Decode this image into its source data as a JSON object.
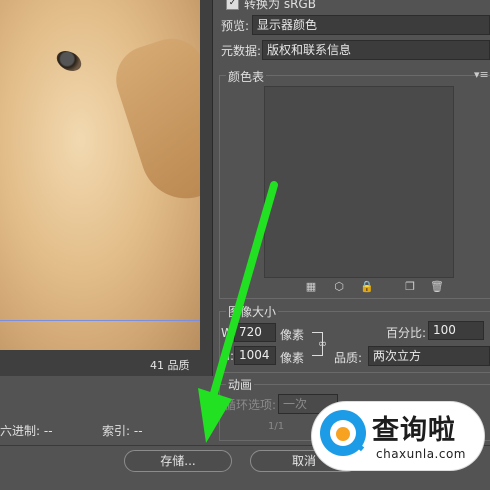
{
  "settings": {
    "convert_srgb_label": "转换为 sRGB",
    "convert_srgb_checked": true,
    "preview_label": "预览:",
    "preview_value": "显示器颜色",
    "metadata_label": "元数据:",
    "metadata_value": "版权和联系信息"
  },
  "color_table": {
    "legend": "颜色表",
    "menu_icon": "panel-menu-icon",
    "toolbar_icons": [
      "web-shift-icon",
      "cube-icon",
      "lock-icon",
      "new-color-icon",
      "trash-icon"
    ]
  },
  "image_size": {
    "legend": "图像大小",
    "width_label": "W:",
    "width_value": "720",
    "width_unit": "像素",
    "height_label": "H:",
    "height_value": "1004",
    "height_unit": "像素",
    "percent_label": "百分比:",
    "percent_value": "100",
    "quality_label": "品质:",
    "quality_value": "两次立方"
  },
  "animation": {
    "legend": "动画",
    "loop_label": "循环选项:",
    "loop_value": "一次",
    "frame_counter": "1/1"
  },
  "preview": {
    "quality_text": "41 品质",
    "guide_color": "#7b8fe0"
  },
  "status": {
    "hex_label": "六进制: --",
    "index_label": "索引: --"
  },
  "buttons": {
    "save": "存储...",
    "cancel": "取消"
  },
  "watermark": {
    "title": "查询啦",
    "url": "chaxunla.com",
    "brand_blue": "#1c9be6",
    "brand_orange": "#f7a221"
  },
  "annotation": {
    "arrow_color": "#22e022"
  }
}
